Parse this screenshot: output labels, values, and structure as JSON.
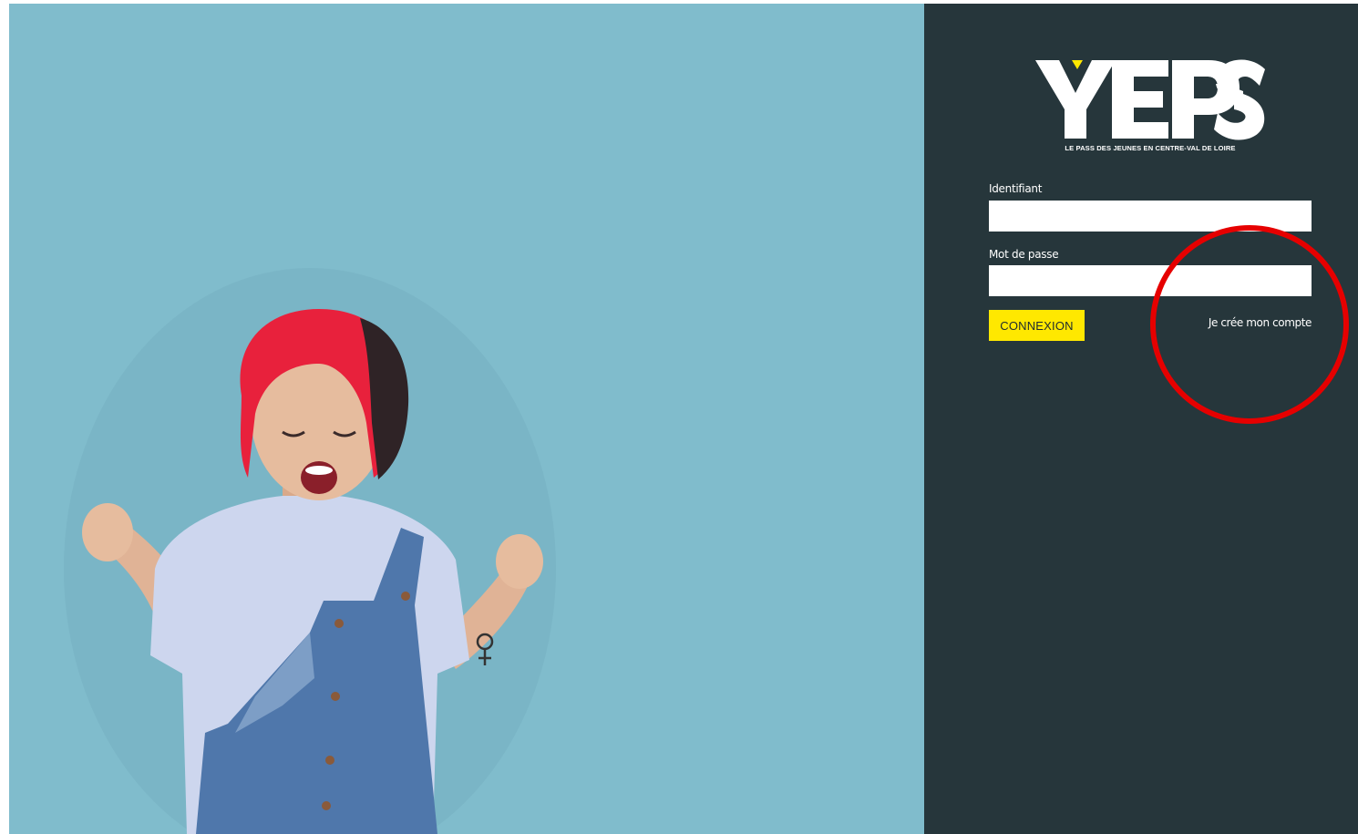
{
  "brand": {
    "logo_text": "YEPS",
    "tagline": "LE PASS DES JEUNES EN CENTRE-VAL DE LOIRE"
  },
  "login": {
    "identifiant_label": "Identifiant",
    "identifiant_value": "",
    "password_label": "Mot de passe",
    "password_value": "",
    "submit_label": "CONNEXION",
    "create_account_label": "Je crée mon compte"
  },
  "colors": {
    "hero_background": "#80bccc",
    "panel_background": "#26363b",
    "accent_yellow": "#ffe800",
    "annotation_red": "#e60000"
  },
  "hero": {
    "icon": "celebrating-person-photo"
  },
  "annotation": {
    "icon": "red-circle-annotation"
  }
}
